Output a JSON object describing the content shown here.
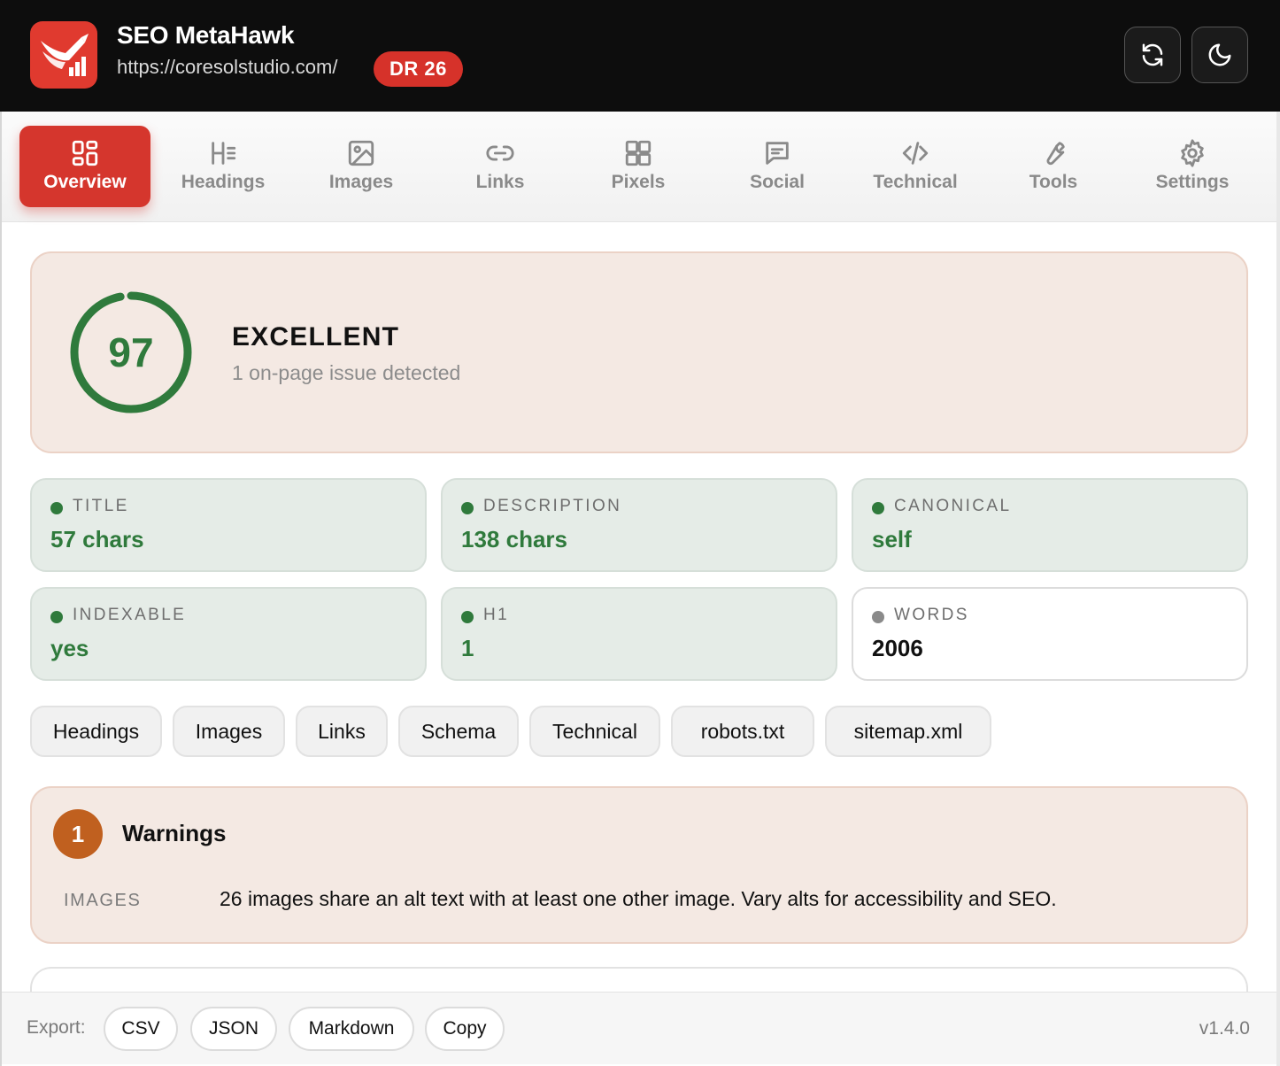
{
  "header": {
    "app_title": "SEO MetaHawk",
    "url": "https://coresolstudio.com/",
    "dr_badge": "DR 26",
    "refresh_icon": "refresh-icon",
    "theme_icon": "moon-icon",
    "brand_color": "#e03a2f"
  },
  "tabs": [
    {
      "label": "Overview",
      "icon": "grid-icon",
      "active": true
    },
    {
      "label": "Headings",
      "icon": "heading-icon"
    },
    {
      "label": "Images",
      "icon": "image-icon"
    },
    {
      "label": "Links",
      "icon": "link-icon"
    },
    {
      "label": "Pixels",
      "icon": "pixels-grid-icon"
    },
    {
      "label": "Social",
      "icon": "message-icon"
    },
    {
      "label": "Technical",
      "icon": "code-icon"
    },
    {
      "label": "Tools",
      "icon": "wrench-icon"
    },
    {
      "label": "Settings",
      "icon": "gear-icon"
    }
  ],
  "score": {
    "value": "97",
    "label": "EXCELLENT",
    "subtitle": "1 on-page issue detected",
    "color": "#2f7a3c"
  },
  "stats": [
    {
      "label": "TITLE",
      "value": "57 chars",
      "status": "good"
    },
    {
      "label": "DESCRIPTION",
      "value": "138 chars",
      "status": "good"
    },
    {
      "label": "CANONICAL",
      "value": "self",
      "status": "good"
    },
    {
      "label": "INDEXABLE",
      "value": "yes",
      "status": "good"
    },
    {
      "label": "H1",
      "value": "1",
      "status": "good"
    },
    {
      "label": "WORDS",
      "value": "2006",
      "status": "neutral"
    }
  ],
  "quick_links": [
    "Headings",
    "Images",
    "Links",
    "Schema",
    "Technical",
    "robots.txt",
    "sitemap.xml"
  ],
  "warnings": {
    "count": "1",
    "title": "Warnings",
    "items": [
      {
        "category": "IMAGES",
        "message": "26 images share an alt text with at least one other image. Vary alts for accessibility and SEO."
      }
    ],
    "color": "#c0601f"
  },
  "footer": {
    "export_label": "Export:",
    "buttons": [
      "CSV",
      "JSON",
      "Markdown",
      "Copy"
    ],
    "version": "v1.4.0"
  }
}
